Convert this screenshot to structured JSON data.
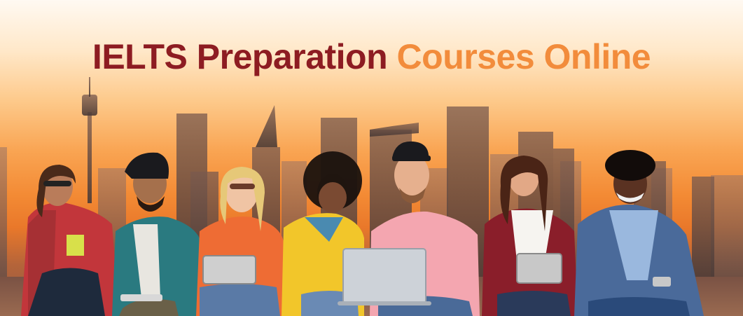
{
  "banner": {
    "headline_part1": "IELTS Preparation",
    "headline_part2": "Courses Online",
    "colors": {
      "headline_dark": "#8d1c22",
      "headline_light": "#f28c3c",
      "sky_top": "#fff9f2",
      "sky_bottom": "#f38a34"
    }
  }
}
